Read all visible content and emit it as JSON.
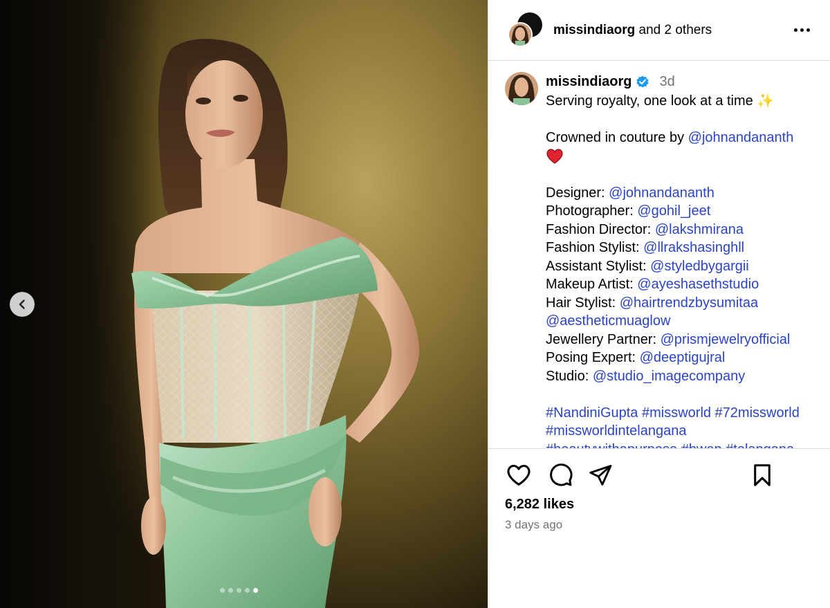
{
  "post": {
    "header": {
      "username": "missindiaorg",
      "coauthors_text": "and 2 others"
    },
    "caption": {
      "username": "missindiaorg",
      "time_ago": "3d",
      "lines": [
        {
          "text": "Serving royalty, one look at a time ✨"
        },
        {
          "text": ""
        },
        {
          "text": "Crowned in couture by ",
          "mention": "@johnandananth"
        },
        {
          "emoji": "red-heart"
        },
        {
          "text": ""
        },
        {
          "text": "Designer: ",
          "mention": "@johnandananth"
        },
        {
          "text": "Photographer: ",
          "mention": "@gohil_jeet"
        },
        {
          "text": "Fashion Director: ",
          "mention": "@lakshmirana"
        },
        {
          "text": "Fashion Stylist: ",
          "mention": "@llrakshasinghll"
        },
        {
          "text": "Assistant Stylist: ",
          "mention": "@styledbygargii"
        },
        {
          "text": "Makeup Artist: ",
          "mention": "@ayeshasethstudio"
        },
        {
          "text": "Hair Stylist: ",
          "mention": "@hairtrendzbysumitaa"
        },
        {
          "text": "",
          "mention": "@aestheticmuaglow"
        },
        {
          "text": "Jewellery Partner: ",
          "mention": "@prismjewelryofficial"
        },
        {
          "text": "Posing Expert: ",
          "mention": "@deeptigujral"
        },
        {
          "text": "Studio: ",
          "mention": "@studio_imagecompany"
        },
        {
          "text": ""
        },
        {
          "text": "",
          "mention": "#NandiniGupta #missworld #72missworld"
        },
        {
          "text": "",
          "mention": "#missworldintelangana"
        },
        {
          "text": "",
          "mention": "#beautywithapurpose #bwap #telangana"
        }
      ]
    },
    "likes_text": "6,282 likes",
    "posted_text": "3 days ago",
    "carousel": {
      "count": 5,
      "active_index": 4
    },
    "colors": {
      "link": "#2b44c7",
      "muted": "#737373",
      "verified": "#1d9bf0",
      "divider": "#dbdbdb"
    },
    "icons": [
      "chevron-left-icon",
      "more-options-icon",
      "verified-badge-icon",
      "heart-icon",
      "comment-icon",
      "share-icon",
      "bookmark-icon"
    ]
  }
}
